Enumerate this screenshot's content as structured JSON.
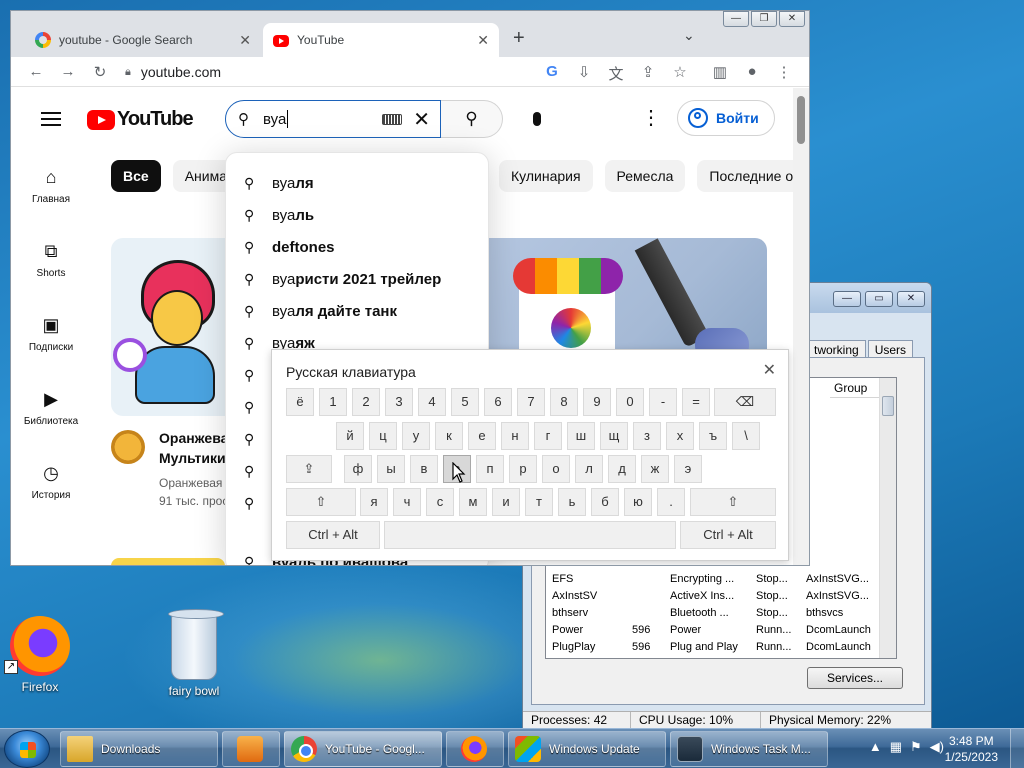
{
  "desktop": {
    "icons": [
      {
        "label": "Firefox"
      },
      {
        "label": "fairy bowl"
      }
    ]
  },
  "task_manager": {
    "tabs": [
      "tworking",
      "Users"
    ],
    "column_header": "Group",
    "rows": [
      [
        "EFS",
        "",
        "Encrypting ...",
        "Stop...",
        "AxInstSVG..."
      ],
      [
        "AxInstSV",
        "",
        "ActiveX Ins...",
        "Stop...",
        "AxInstSVG..."
      ],
      [
        "bthserv",
        "",
        "Bluetooth ...",
        "Stop...",
        "bthsvcs"
      ],
      [
        "Power",
        "596",
        "Power",
        "Runn...",
        "DcomLaunch"
      ],
      [
        "PlugPlay",
        "596",
        "Plug and Play",
        "Runn...",
        "DcomLaunch"
      ]
    ],
    "services_button": "Services...",
    "status": {
      "processes": "Processes: 42",
      "cpu": "CPU Usage: 10%",
      "memory": "Physical Memory: 22%"
    }
  },
  "chrome": {
    "tabs": [
      {
        "title": "youtube - Google Search",
        "active": false
      },
      {
        "title": "YouTube",
        "active": true
      }
    ],
    "url": "youtube.com"
  },
  "youtube": {
    "logo_text": "YouTube",
    "search_value": "вуа",
    "signin_label": "Войти",
    "guide": [
      {
        "label": "Главная",
        "icon": "home-icon"
      },
      {
        "label": "Shorts",
        "icon": "shorts-icon"
      },
      {
        "label": "Подписки",
        "icon": "subscriptions-icon"
      },
      {
        "label": "Библиотека",
        "icon": "library-icon"
      },
      {
        "label": "История",
        "icon": "history-icon"
      }
    ],
    "chips": [
      "Все",
      "Анима",
      "Кулинария",
      "Ремесла",
      "Последние опу"
    ],
    "video": {
      "title_line1": "Оранжева",
      "title_line2": "Мультики",
      "channel": "Оранжевая",
      "views": "91 тыс. прос"
    },
    "suggestions": [
      {
        "prefix": "вуа",
        "suffix": "ля"
      },
      {
        "prefix": "вуа",
        "suffix": "ль"
      },
      {
        "prefix": "",
        "suffix": "deftones"
      },
      {
        "prefix": "вуа",
        "suffix": "ристи 2021 трейлер"
      },
      {
        "prefix": "вуа",
        "suffix": "ля дайте танк"
      },
      {
        "prefix": "вуа",
        "suffix": "яж"
      }
    ],
    "partial_suggestion": "вуаль по ивашова"
  },
  "keyboard": {
    "title": "Русская клавиатура",
    "row1": [
      "ё",
      "1",
      "2",
      "3",
      "4",
      "5",
      "6",
      "7",
      "8",
      "9",
      "0",
      "-",
      "="
    ],
    "row2": [
      "й",
      "ц",
      "у",
      "к",
      "е",
      "н",
      "г",
      "ш",
      "щ",
      "з",
      "х",
      "ъ",
      "\\"
    ],
    "row3": [
      "ф",
      "ы",
      "в",
      "а",
      "п",
      "р",
      "о",
      "л",
      "д",
      "ж",
      "э"
    ],
    "row4": [
      "я",
      "ч",
      "с",
      "м",
      "и",
      "т",
      "ь",
      "б",
      "ю",
      "."
    ],
    "ctrl_alt": "Ctrl + Alt"
  },
  "taskbar": {
    "items": [
      {
        "label": "Downloads"
      },
      {
        "label": ""
      },
      {
        "label": "YouTube - Googl..."
      },
      {
        "label": ""
      },
      {
        "label": "Windows Update"
      },
      {
        "label": "Windows Task M..."
      }
    ],
    "time": "3:48 PM",
    "date": "1/25/2023"
  }
}
